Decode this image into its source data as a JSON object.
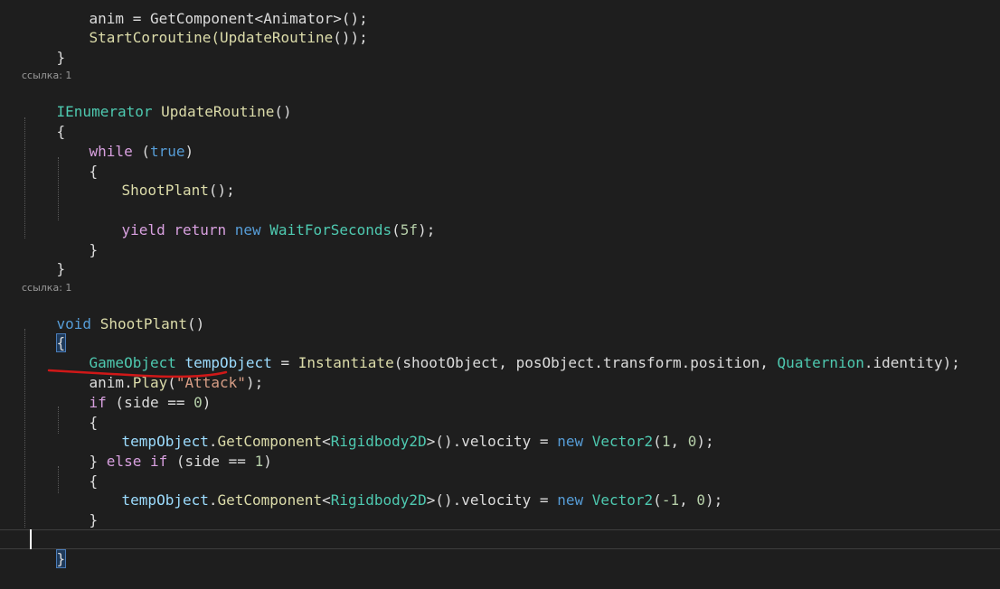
{
  "codelens": [
    "ссылка: 1",
    "ссылка: 1"
  ],
  "lines": {
    "l0": "anim = GetComponent<Animator>();",
    "l1_a": "StartCoroutine(",
    "l1_b": "UpdateRoutine",
    "l1_c": "());",
    "l2": "}",
    "l3_a": "IEnumerator",
    "l3_b": " UpdateRoutine",
    "l3_c": "()",
    "l4": "{",
    "l5_a": "while",
    "l5_b": " (",
    "l5_c": "true",
    "l5_d": ")",
    "l6": "{",
    "l7_a": "ShootPlant",
    "l7_b": "();",
    "l8_a": "yield return",
    "l8_b": " new",
    "l8_c": " WaitForSeconds",
    "l8_d": "(",
    "l8_e": "5f",
    "l8_f": ");",
    "l9": "}",
    "l10": "}",
    "l11_a": "void",
    "l11_b": " ShootPlant",
    "l11_c": "()",
    "l12": "{",
    "l13_a": "GameObject",
    "l13_b": " tempObject",
    "l13_c": " = ",
    "l13_d": "Instantiate",
    "l13_e": "(shootObject, posObject.transform.position, ",
    "l13_f": "Quaternion",
    "l13_g": ".identity);",
    "l14_a": "anim",
    "l14_b": ".",
    "l14_c": "Play",
    "l14_d": "(",
    "l14_e": "\"Attack\"",
    "l14_f": ");",
    "l15_a": "if",
    "l15_b": " (side == ",
    "l15_c": "0",
    "l15_d": ")",
    "l16": "{",
    "l17_a": "tempObject",
    "l17_b": ".",
    "l17_c": "GetComponent",
    "l17_d": "<",
    "l17_e": "Rigidbody2D",
    "l17_f": ">().velocity = ",
    "l17_g": "new",
    "l17_h": " Vector2",
    "l17_i": "(",
    "l17_j": "1",
    "l17_k": ", ",
    "l17_l": "0",
    "l17_m": ");",
    "l18_a": "} ",
    "l18_b": "else if",
    "l18_c": " (side == ",
    "l18_d": "1",
    "l18_e": ")",
    "l19": "{",
    "l20_a": "tempObject",
    "l20_b": ".",
    "l20_c": "GetComponent",
    "l20_d": "<",
    "l20_e": "Rigidbody2D",
    "l20_f": ">().velocity = ",
    "l20_g": "new",
    "l20_h": " Vector2",
    "l20_i": "(",
    "l20_j": "-1",
    "l20_k": ", ",
    "l20_l": "0",
    "l20_m": ");",
    "l21": "}",
    "l22": "}"
  },
  "colors": {
    "background": "#1e1e1e",
    "keyword": "#569cd6",
    "control_keyword": "#d8a0df",
    "type": "#4ec9b0",
    "method": "#dcdcaa",
    "variable": "#9cdcfe",
    "number": "#b5cea8",
    "string": "#d69d85",
    "annotation": "#d01818"
  }
}
